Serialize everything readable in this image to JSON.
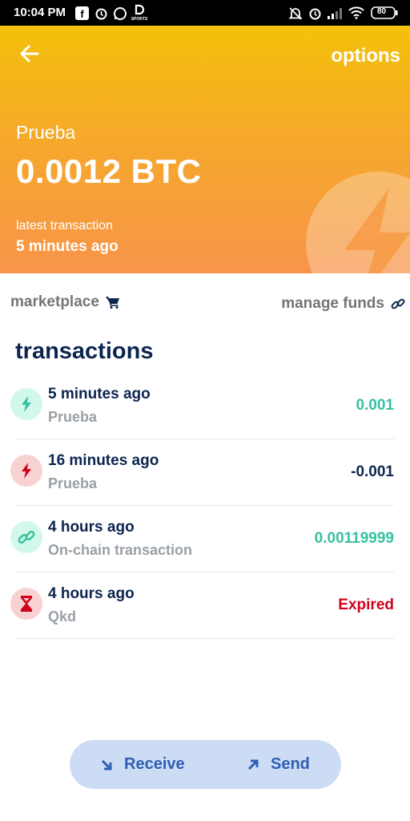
{
  "status_bar": {
    "time": "10:04 PM",
    "battery": "80"
  },
  "header": {
    "options_label": "options",
    "wallet_name": "Prueba",
    "balance": "0.0012 BTC",
    "latest_label": "latest transaction",
    "latest_value": "5 minutes ago",
    "gradient_colors": [
      "#f4c10a",
      "#f7944a"
    ]
  },
  "links": {
    "marketplace": "marketplace",
    "manage_funds": "manage funds"
  },
  "transactions_title": "transactions",
  "transactions": [
    {
      "time": "5 minutes ago",
      "memo": "Prueba",
      "amount": "0.001",
      "icon": "lightning-icon",
      "amount_color": "#37c0a1",
      "icon_bg": "#d2f8e9",
      "icon_color": "#37c0a1"
    },
    {
      "time": "16 minutes ago",
      "memo": "Prueba",
      "amount": "-0.001",
      "icon": "lightning-icon",
      "amount_color": "#0c2550",
      "icon_bg": "#f8d2d2",
      "icon_color": "#d0021b"
    },
    {
      "time": "4 hours ago",
      "memo": "On-chain transaction",
      "amount": "0.00119999",
      "icon": "link-icon",
      "amount_color": "#37c0a1",
      "icon_bg": "#d2f8e9",
      "icon_color": "#37c0a1"
    },
    {
      "time": "4 hours ago",
      "memo": "Qkd",
      "amount": "Expired",
      "icon": "hourglass-icon",
      "amount_color": "#d0021b",
      "icon_bg": "#f8d2d2",
      "icon_color": "#d0021b"
    }
  ],
  "actions": {
    "receive": "Receive",
    "send": "Send"
  }
}
